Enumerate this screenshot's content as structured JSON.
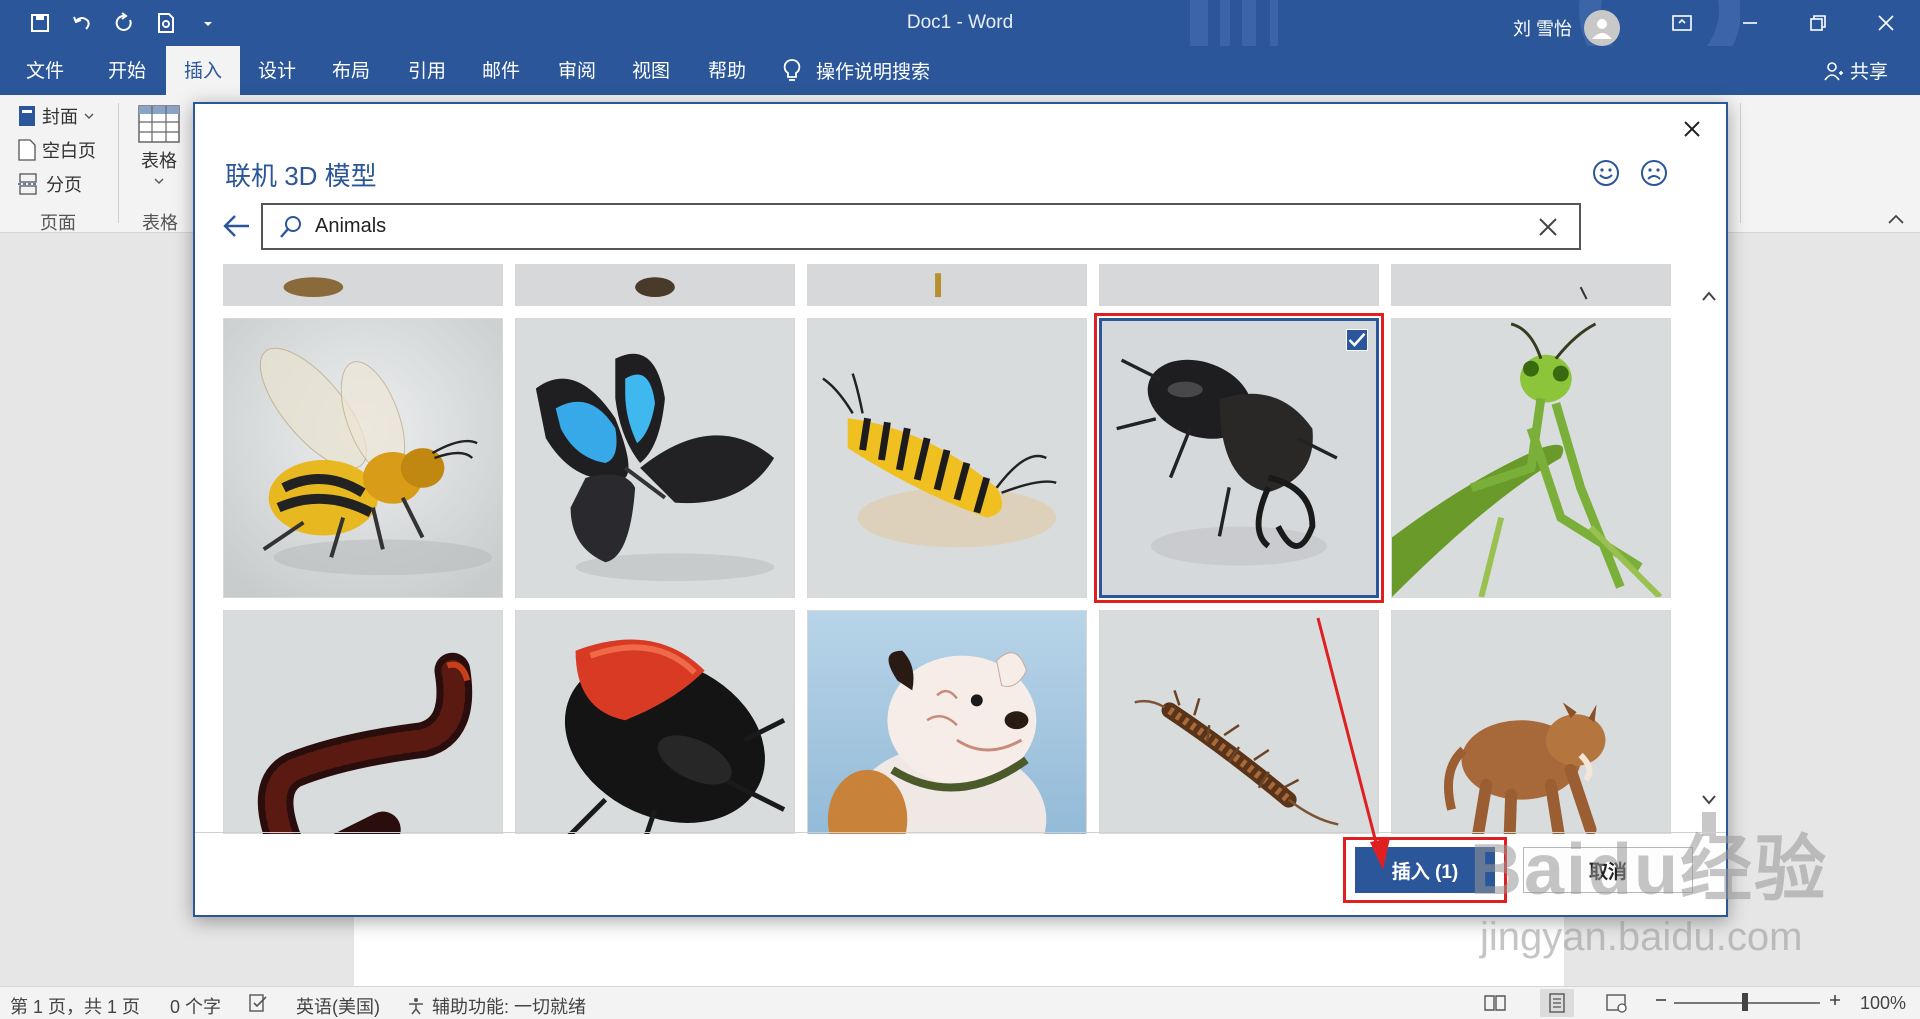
{
  "window": {
    "title": "Doc1  -  Word",
    "user_name": "刘 雪怡",
    "share_label": "共享"
  },
  "ribbon_tabs": [
    {
      "label": "文件"
    },
    {
      "label": "开始"
    },
    {
      "label": "插入",
      "active": true
    },
    {
      "label": "设计"
    },
    {
      "label": "布局"
    },
    {
      "label": "引用"
    },
    {
      "label": "邮件"
    },
    {
      "label": "审阅"
    },
    {
      "label": "视图"
    },
    {
      "label": "帮助"
    }
  ],
  "tell_me": "操作说明搜索",
  "ribbon": {
    "pages_group": {
      "cover_label": "封面",
      "blank_label": "空白页",
      "break_label": "分页",
      "group_label": "页面"
    },
    "tables_group": {
      "table_label": "表格",
      "group_label": "表格"
    }
  },
  "dialog": {
    "title": "联机 3D 模型",
    "search_value": "Animals",
    "insert_label": "插入 (1)",
    "cancel_label": "取消"
  },
  "models": [
    {
      "name": "bee"
    },
    {
      "name": "butterfly"
    },
    {
      "name": "caterpillar"
    },
    {
      "name": "stag-beetle",
      "selected": true
    },
    {
      "name": "praying-mantis"
    },
    {
      "name": "millipede"
    },
    {
      "name": "cockroach"
    },
    {
      "name": "bulldog"
    },
    {
      "name": "centipede"
    },
    {
      "name": "cougar"
    }
  ],
  "status": {
    "page": "第 1 页，共 1 页",
    "words": "0 个字",
    "language": "英语(美国)",
    "accessibility": "辅助功能: 一切就绪",
    "zoom": "100%"
  },
  "watermark": {
    "main": "Baidu经验",
    "sub": "jingyan.baidu.com"
  },
  "colors": {
    "brand": "#2b579a",
    "highlight": "#e02020"
  }
}
